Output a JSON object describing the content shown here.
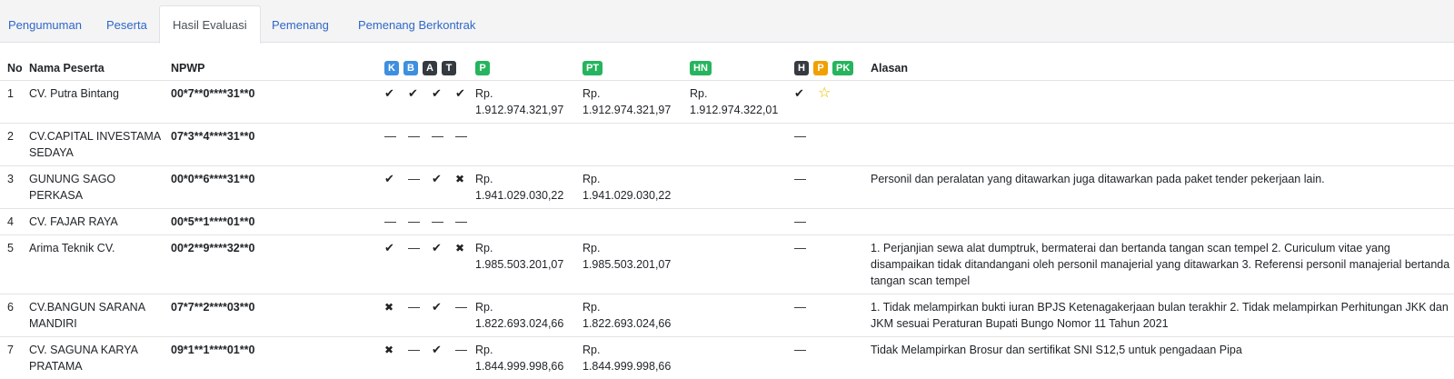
{
  "tabs": [
    {
      "label": "Pengumuman",
      "active": false
    },
    {
      "label": "Peserta",
      "active": false
    },
    {
      "label": "Hasil Evaluasi",
      "active": true
    },
    {
      "label": "Pemenang",
      "active": false
    },
    {
      "label": "Pemenang Berkontrak",
      "active": false
    }
  ],
  "table": {
    "headers": {
      "no": "No",
      "nama": "Nama Peserta",
      "npwp": "NPWP",
      "k": "K",
      "b": "B",
      "a": "A",
      "t": "T",
      "p": "P",
      "pt": "PT",
      "hn": "HN",
      "h": "H",
      "p2": "P",
      "pk": "PK",
      "alasan": "Alasan"
    },
    "badge_colors": {
      "blue": "#3d8fe0",
      "dark": "#343a40",
      "green": "#26b45e",
      "orange": "#f0a000"
    },
    "rows": [
      {
        "no": "1",
        "nama": "CV. Putra Bintang",
        "npwp": "00*7**0****31**0",
        "marks": [
          "check",
          "check",
          "check",
          "check"
        ],
        "p": [
          "Rp.",
          "1.912.974.321,97"
        ],
        "pt": [
          "Rp.",
          "1.912.974.321,97"
        ],
        "hn": [
          "Rp.",
          "1.912.974.322,01"
        ],
        "h": "check",
        "pwin": "star",
        "alasan": ""
      },
      {
        "no": "2",
        "nama": "CV.CAPITAL INVESTAMA SEDAYA",
        "npwp": "07*3**4****31**0",
        "marks": [
          "dash",
          "dash",
          "dash",
          "dash"
        ],
        "p": [
          "",
          ""
        ],
        "pt": [
          "",
          ""
        ],
        "hn": [
          "",
          ""
        ],
        "h": "dash",
        "pwin": "",
        "alasan": ""
      },
      {
        "no": "3",
        "nama": "GUNUNG SAGO PERKASA",
        "npwp": "00*0**6****31**0",
        "marks": [
          "check",
          "dash",
          "check",
          "cross"
        ],
        "p": [
          "Rp.",
          "1.941.029.030,22"
        ],
        "pt": [
          "Rp.",
          "1.941.029.030,22"
        ],
        "hn": [
          "",
          ""
        ],
        "h": "dash",
        "pwin": "",
        "alasan": "Personil dan peralatan yang ditawarkan juga ditawarkan pada paket tender pekerjaan lain."
      },
      {
        "no": "4",
        "nama": "CV. FAJAR RAYA",
        "npwp": "00*5**1****01**0",
        "marks": [
          "dash",
          "dash",
          "dash",
          "dash"
        ],
        "p": [
          "",
          ""
        ],
        "pt": [
          "",
          ""
        ],
        "hn": [
          "",
          ""
        ],
        "h": "dash",
        "pwin": "",
        "alasan": ""
      },
      {
        "no": "5",
        "nama": "Arima Teknik CV.",
        "npwp": "00*2**9****32**0",
        "marks": [
          "check",
          "dash",
          "check",
          "cross"
        ],
        "p": [
          "Rp.",
          "1.985.503.201,07"
        ],
        "pt": [
          "Rp.",
          "1.985.503.201,07"
        ],
        "hn": [
          "",
          ""
        ],
        "h": "dash",
        "pwin": "",
        "alasan": "1. Perjanjian sewa alat dumptruk, bermaterai dan bertanda tangan scan tempel 2. Curiculum vitae yang disampaikan tidak ditandangani oleh personil manajerial yang ditawarkan 3. Referensi personil manajerial bertanda tangan scan tempel"
      },
      {
        "no": "6",
        "nama": "CV.BANGUN SARANA MANDIRI",
        "npwp": "07*7**2****03**0",
        "marks": [
          "cross",
          "dash",
          "check",
          "dash"
        ],
        "p": [
          "Rp.",
          "1.822.693.024,66"
        ],
        "pt": [
          "Rp.",
          "1.822.693.024,66"
        ],
        "hn": [
          "",
          ""
        ],
        "h": "dash",
        "pwin": "",
        "alasan": "1. Tidak melampirkan bukti iuran BPJS Ketenagakerjaan bulan terakhir 2. Tidak melampirkan Perhitungan JKK dan JKM sesuai Peraturan Bupati Bungo Nomor 11 Tahun 2021"
      },
      {
        "no": "7",
        "nama": "CV. SAGUNA KARYA PRATAMA",
        "npwp": "09*1**1****01**0",
        "marks": [
          "cross",
          "dash",
          "check",
          "dash"
        ],
        "p": [
          "Rp.",
          "1.844.999.998,66"
        ],
        "pt": [
          "Rp.",
          "1.844.999.998,66"
        ],
        "hn": [
          "",
          ""
        ],
        "h": "dash",
        "pwin": "",
        "alasan": "Tidak Melampirkan Brosur dan sertifikat SNI S12,5 untuk pengadaan Pipa"
      }
    ]
  }
}
